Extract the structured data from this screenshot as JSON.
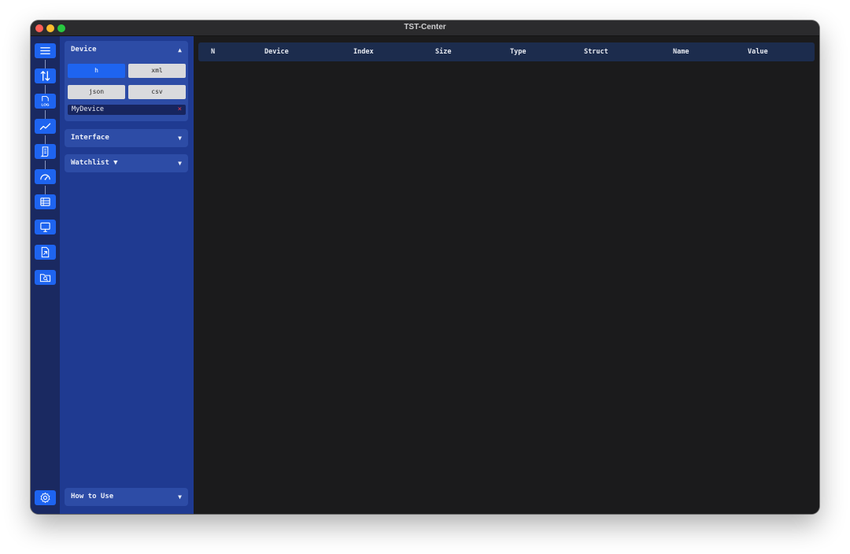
{
  "window": {
    "title": "TST-Center"
  },
  "iconbar": {
    "items": [
      {
        "icon": "menu-icon"
      },
      {
        "icon": "transfer-arrows-icon"
      },
      {
        "icon": "log-file-icon",
        "label": "LOG"
      },
      {
        "icon": "line-chart-icon"
      },
      {
        "icon": "script-icon"
      },
      {
        "icon": "gauge-icon"
      },
      {
        "icon": "table-icon"
      },
      {
        "icon": "monitor-icon"
      },
      {
        "icon": "file-export-icon"
      },
      {
        "icon": "folder-search-icon"
      }
    ],
    "settings_icon": "gear-icon"
  },
  "sidebar": {
    "device": {
      "title": "Device",
      "chevron": "▲",
      "formats": [
        "h",
        "xml",
        "json",
        "csv"
      ],
      "active_format": "h",
      "device_name": "MyDevice",
      "clear": "×"
    },
    "interface": {
      "title": "Interface",
      "chevron": "▼"
    },
    "watchlist": {
      "title": "Watchlist ▼",
      "chevron": "▼"
    },
    "howto": {
      "title": "How to Use",
      "chevron": "▼"
    }
  },
  "table": {
    "columns": [
      "N",
      "Device",
      "Index",
      "Size",
      "Type",
      "Struct",
      "Name",
      "Value"
    ],
    "rows": []
  },
  "colors": {
    "accent": "#1e64f0",
    "sidebar_bg": "#1f3a91",
    "iconbar_bg": "#1a2961",
    "panel_bg": "#2d4ca6",
    "main_bg": "#1b1b1c",
    "table_header_bg": "#1c2c4d",
    "clear_red": "#e33b4c"
  }
}
